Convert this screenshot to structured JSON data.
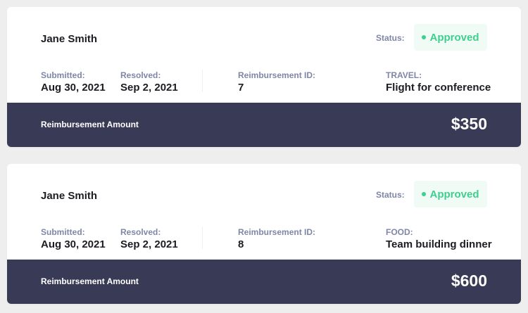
{
  "colors": {
    "page_background": "#eeeeee",
    "card_background": "#ffffff",
    "footer_background": "#393b56",
    "approved_text": "#3ecf8e",
    "approved_badge_background": "#f1fbf6",
    "label_text": "#7f86a6"
  },
  "reimbursements": [
    {
      "employee_name": "Jane Smith",
      "status_label": "Status:",
      "status": "Approved",
      "status_icon": "dot-icon",
      "submitted_label": "Submitted:",
      "submitted_date": "Aug 30, 2021",
      "resolved_label": "Resolved:",
      "resolved_date": "Sep 2, 2021",
      "id_label": "Reimbursement ID:",
      "id": "7",
      "category": "TRAVEL:",
      "description": "Flight for conference",
      "amount_label": "Reimbursement Amount",
      "amount": "$350"
    },
    {
      "employee_name": "Jane Smith",
      "status_label": "Status:",
      "status": "Approved",
      "status_icon": "dot-icon",
      "submitted_label": "Submitted:",
      "submitted_date": "Aug 30, 2021",
      "resolved_label": "Resolved:",
      "resolved_date": "Sep 2, 2021",
      "id_label": "Reimbursement ID:",
      "id": "8",
      "category": "FOOD:",
      "description": "Team building dinner",
      "amount_label": "Reimbursement Amount",
      "amount": "$600"
    }
  ]
}
